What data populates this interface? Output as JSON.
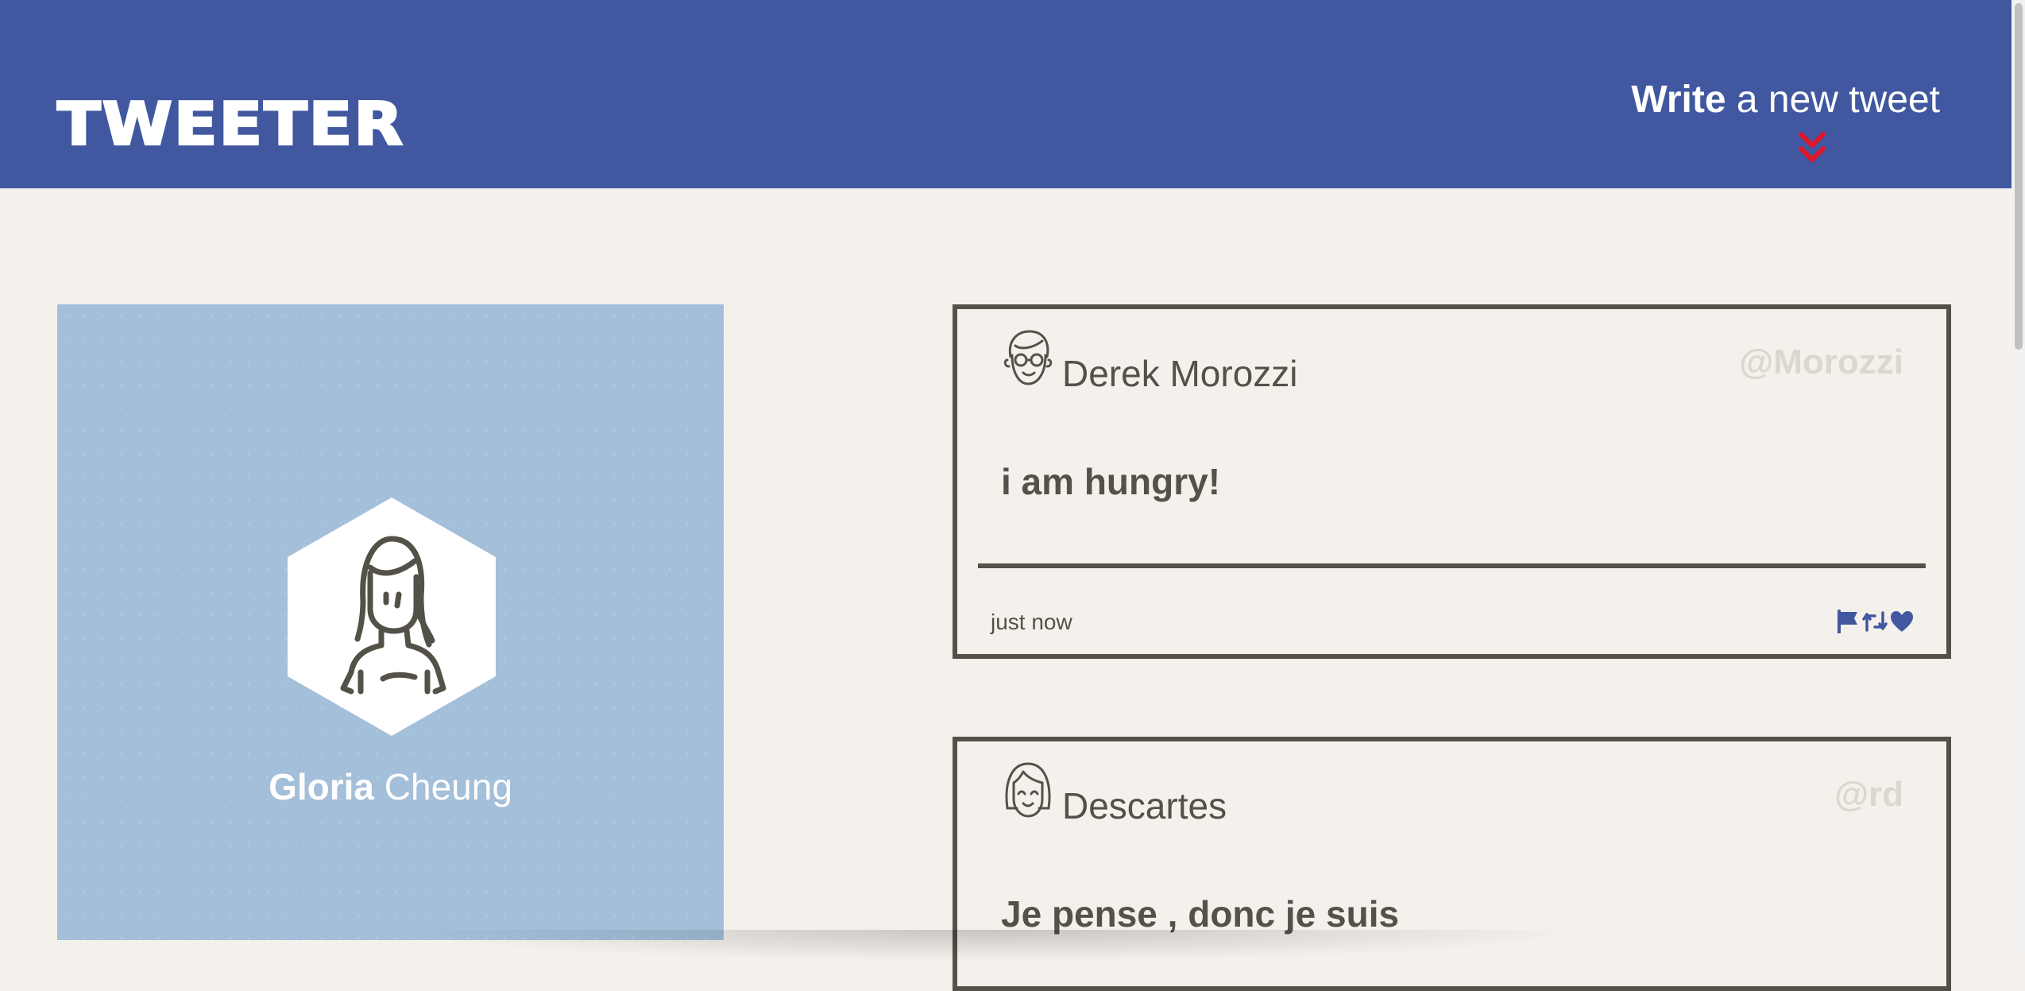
{
  "header": {
    "logo": "TWEETER",
    "compose_bold": "Write",
    "compose_rest": " a new tweet",
    "accent_color": "#4158a0",
    "arrow_color": "#e0152a",
    "arrow_icon": "double-chevron-down-icon"
  },
  "profile": {
    "first_name": "Gloria",
    "last_name": " Cheung",
    "background_color": "#a3bfd9",
    "avatar_icon": "woman-avatar-icon"
  },
  "tweets": [
    {
      "name": "Derek Morozzi",
      "handle": "@Morozzi",
      "content": "i am hungry!",
      "time": "just now",
      "avatar_icon": "man-glasses-avatar-icon",
      "actions": [
        "flag-icon",
        "retweet-icon",
        "heart-icon"
      ]
    },
    {
      "name": "Descartes",
      "handle": "@rd",
      "content": "Je pense , donc je suis",
      "avatar_icon": "bob-hair-avatar-icon"
    }
  ]
}
